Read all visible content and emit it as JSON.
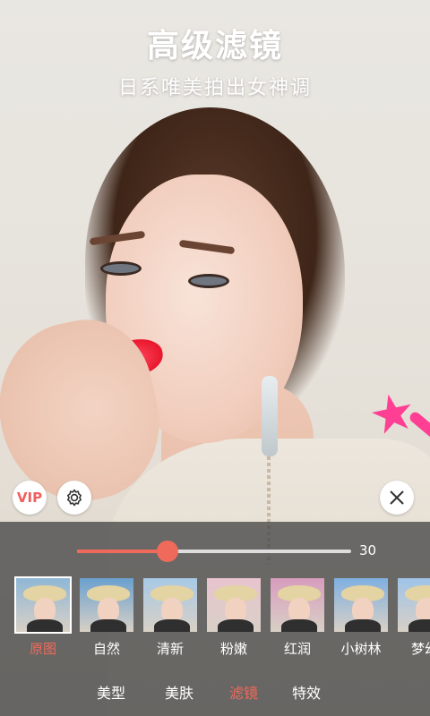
{
  "banner": {
    "title": "高级滤镜",
    "subtitle": "日系唯美拍出女神调"
  },
  "controls": {
    "vip_label": "VIP",
    "settings_icon": "gear-icon",
    "close_icon": "close-icon"
  },
  "slider": {
    "value": 30,
    "value_text": "30",
    "fill_fraction": 0.33,
    "accent": "#f06a5b"
  },
  "filters": [
    {
      "label": "原图",
      "selected": true,
      "tint": "#8fb7d6"
    },
    {
      "label": "自然",
      "selected": false,
      "tint": "#6aa0cf"
    },
    {
      "label": "清新",
      "selected": false,
      "tint": "#a8c9e6"
    },
    {
      "label": "粉嫩",
      "selected": false,
      "tint": "#e9c4cf"
    },
    {
      "label": "红润",
      "selected": false,
      "tint": "#d79cbd"
    },
    {
      "label": "小树林",
      "selected": false,
      "tint": "#7fb0e0"
    },
    {
      "label": "梦幻",
      "selected": false,
      "tint": "#9fc4e8"
    }
  ],
  "tabs": [
    {
      "label": "美型",
      "active": false
    },
    {
      "label": "美肤",
      "active": false
    },
    {
      "label": "滤镜",
      "active": true
    },
    {
      "label": "特效",
      "active": false
    }
  ],
  "colors": {
    "accent": "#f06a5b",
    "star": "#ff3f93",
    "panel": "rgba(70,70,70,0.78)"
  }
}
